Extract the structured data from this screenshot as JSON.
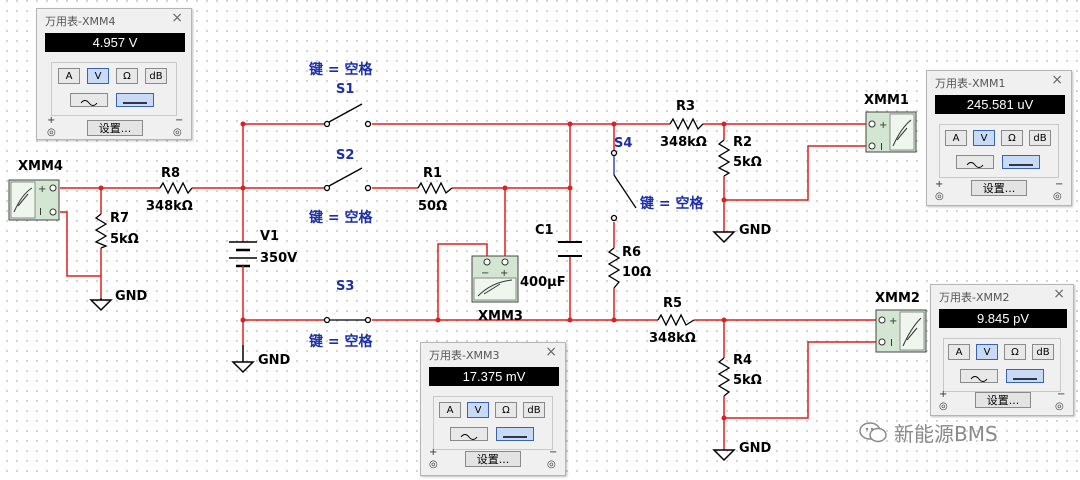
{
  "circuit": {
    "meter_labels": {
      "xmm1": "XMM1",
      "xmm2": "XMM2",
      "xmm3": "XMM3",
      "xmm4": "XMM4"
    },
    "components": {
      "s1": "S1",
      "s2": "S2",
      "s3": "S3",
      "s4": "S4",
      "r1": "R1",
      "r1_value": "50Ω",
      "r2": "R2",
      "r2_value": "5kΩ",
      "r3": "R3",
      "r3_value": "348kΩ",
      "r4": "R4",
      "r4_value": "5kΩ",
      "r5": "R5",
      "r5_value": "348kΩ",
      "r6": "R6",
      "r6_value": "10Ω",
      "r7": "R7",
      "r7_value": "5kΩ",
      "r8": "R8",
      "r8_value": "348kΩ",
      "v1": "V1",
      "v1_value": "350V",
      "c1": "C1",
      "c1_value": "400μF",
      "gnd": "GND"
    },
    "key_label": "键 = 空格",
    "wire_color": "#e01e1e",
    "label_blue": "#1c2fa8"
  },
  "panels": {
    "xmm4": {
      "title": "万用表-XMM4",
      "reading": "4.957 V",
      "selected_mode": "V"
    },
    "xmm1": {
      "title": "万用表-XMM1",
      "reading": "245.581 uV",
      "selected_mode": "V"
    },
    "xmm2": {
      "title": "万用表-XMM2",
      "reading": "9.845 pV",
      "selected_mode": "V"
    },
    "xmm3": {
      "title": "万用表-XMM3",
      "reading": "17.375 mV",
      "selected_mode": "V"
    },
    "common": {
      "mode_a": "A",
      "mode_v": "V",
      "mode_ohm": "Ω",
      "mode_db": "dB",
      "settings": "设置...",
      "close": "×",
      "plus": "+",
      "minus": "−",
      "selected_wave": "DC"
    }
  },
  "watermark": "新能源BMS"
}
